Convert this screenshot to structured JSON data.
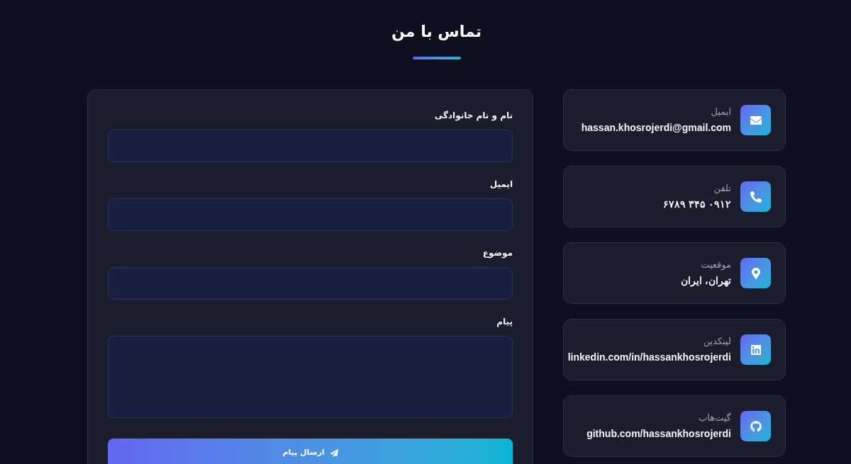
{
  "page": {
    "title": "تماس با من"
  },
  "contact_items": [
    {
      "kind": "email",
      "label": "ایمیل",
      "value": "hassan.khosrojerdi@gmail.com"
    },
    {
      "kind": "phone",
      "label": "تلفن",
      "value": "۰۹۱۲ ۳۴۵ ۶۷۸۹"
    },
    {
      "kind": "location",
      "label": "موقعیت",
      "value": "تهران، ایران"
    },
    {
      "kind": "linkedin",
      "label": "لینکدین",
      "value": "linkedin.com/in/hassankhosrojerdi"
    },
    {
      "kind": "github",
      "label": "گیت‌هاب",
      "value": "github.com/hassankhosrojerdi"
    }
  ],
  "form": {
    "fields": [
      {
        "kind": "input",
        "label": "نام و نام خانوادگی"
      },
      {
        "kind": "input",
        "label": "ایمیل"
      },
      {
        "kind": "input",
        "label": "موضوع"
      },
      {
        "kind": "textarea",
        "label": "پیام"
      }
    ],
    "submit_button": {
      "label": "ارسال پیام"
    }
  }
}
